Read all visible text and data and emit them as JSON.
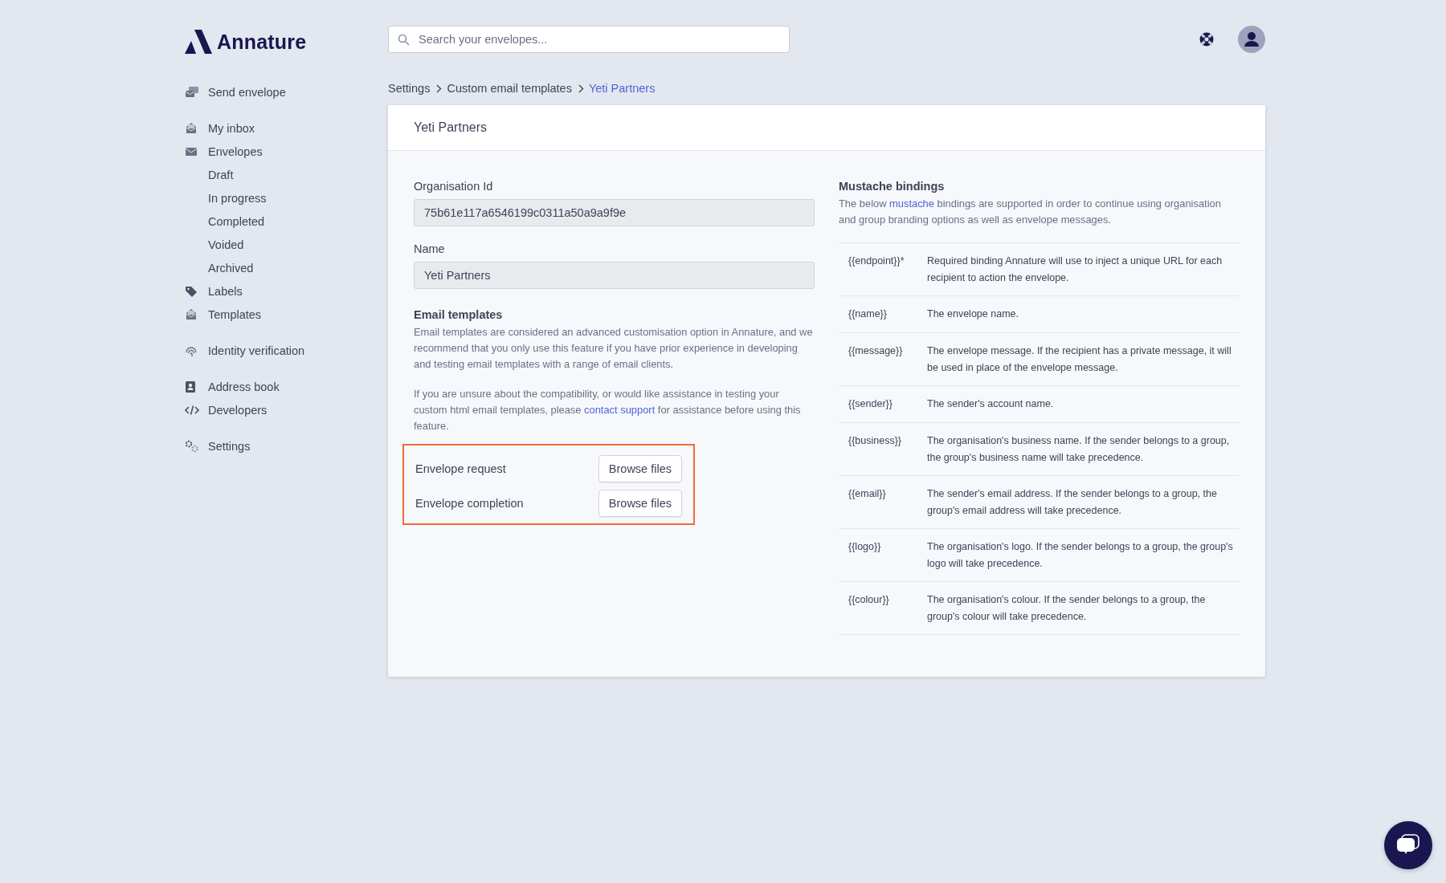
{
  "brand": {
    "name": "Annature"
  },
  "search": {
    "placeholder": "Search your envelopes..."
  },
  "sidebar": {
    "groups": [
      [
        {
          "label": "Send envelope"
        }
      ],
      [
        {
          "label": "My inbox"
        },
        {
          "label": "Envelopes",
          "children": [
            {
              "label": "Draft"
            },
            {
              "label": "In progress"
            },
            {
              "label": "Completed"
            },
            {
              "label": "Voided"
            },
            {
              "label": "Archived"
            }
          ]
        },
        {
          "label": "Labels"
        },
        {
          "label": "Templates"
        }
      ],
      [
        {
          "label": "Identity verification"
        }
      ],
      [
        {
          "label": "Address book"
        },
        {
          "label": "Developers"
        }
      ],
      [
        {
          "label": "Settings"
        }
      ]
    ]
  },
  "breadcrumb": [
    {
      "label": "Settings",
      "current": false
    },
    {
      "label": "Custom email templates",
      "current": false
    },
    {
      "label": "Yeti Partners",
      "current": true
    }
  ],
  "card": {
    "title": "Yeti Partners",
    "fields": [
      {
        "label": "Organisation Id",
        "value": "75b61e117a6546199c0311a50a9a9f9e"
      },
      {
        "label": "Name",
        "value": "Yeti Partners"
      }
    ],
    "email_templates": {
      "heading": "Email templates",
      "paragraphs": [
        {
          "before": "Email templates are considered an advanced customisation option in Annature, and we recommend that you only use this feature if you have prior experience in developing and testing email templates with a range of email clients."
        },
        {
          "before": "If you are unsure about the compatibility, or would like assistance in testing your custom html email templates, please ",
          "link": "contact support",
          "after": " for assistance before using this feature."
        }
      ],
      "highlighted": true,
      "uploads": [
        {
          "label": "Envelope request",
          "button": "Browse files"
        },
        {
          "label": "Envelope completion",
          "button": "Browse files"
        }
      ]
    },
    "bindings": {
      "heading": "Mustache bindings",
      "intro": {
        "before": "The below ",
        "link": "mustache",
        "after": " bindings are supported in order to continue using organisation and group branding options as well as envelope messages."
      },
      "rows": [
        {
          "key": "{{endpoint}}*",
          "description": "Required binding Annature will use to inject a unique URL for each recipient to action the envelope."
        },
        {
          "key": "{{name}}",
          "description": "The envelope name."
        },
        {
          "key": "{{message}}",
          "description": "The envelope message. If the recipient has a private message, it will be used in place of the envelope message."
        },
        {
          "key": "{{sender}}",
          "description": "The sender's account name."
        },
        {
          "key": "{{business}}",
          "description": "The organisation's business name. If the sender belongs to a group, the group's business name will take precedence."
        },
        {
          "key": "{{email}}",
          "description": "The sender's email address. If the sender belongs to a group, the group's email address will take precedence."
        },
        {
          "key": "{{logo}}",
          "description": "The organisation's logo. If the sender belongs to a group, the group's logo will take precedence."
        },
        {
          "key": "{{colour}}",
          "description": "The organisation's colour. If the sender belongs to a group, the group's colour will take precedence."
        }
      ]
    }
  }
}
